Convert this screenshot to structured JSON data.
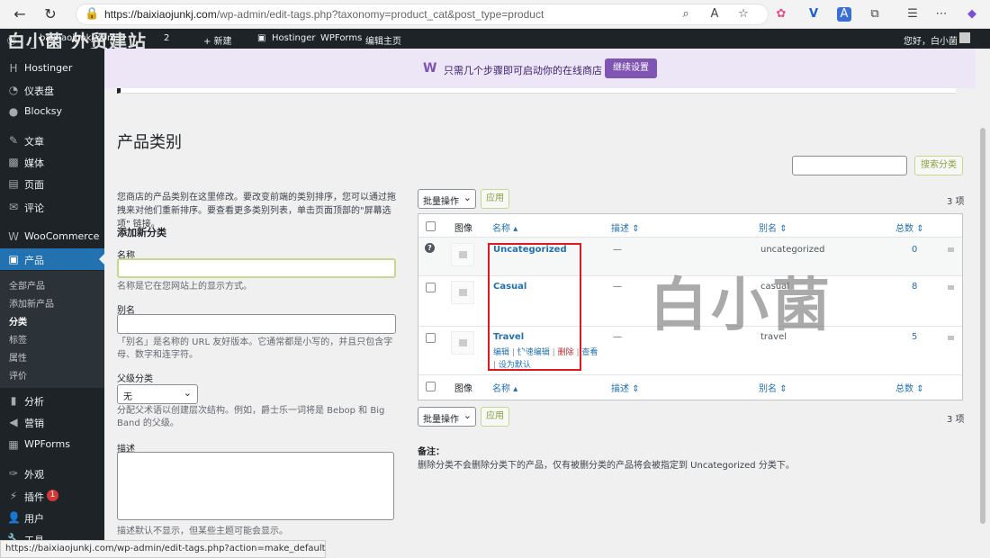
{
  "browser": {
    "url_base": "https://baixiaojunkj.com",
    "url_path": "/wp-admin/edit-tags.php?taxonomy=product_cat&post_type=product",
    "status_url": "https://baixiaojunkj.com/wp-admin/edit-tags.php?action=make_default&taxonom..."
  },
  "adminbar": {
    "site": "baixiaojunkj.com",
    "count": "2",
    "new_label": "+ 新建",
    "hostinger": "Hostinger",
    "wpforms": "WPForms",
    "edit_home": "编辑主页",
    "greeting": "您好，白小菌",
    "overlay_text": "白小菌 外贸建站"
  },
  "sidebar": {
    "items": [
      {
        "label": "Hostinger",
        "icon": "hostinger-icon"
      },
      {
        "label": "仪表盘",
        "icon": "dashboard-icon"
      },
      {
        "label": "Blocksy",
        "icon": "blocksy-icon"
      },
      {
        "label": "文章",
        "icon": "pin-icon"
      },
      {
        "label": "媒体",
        "icon": "media-icon"
      },
      {
        "label": "页面",
        "icon": "page-icon"
      },
      {
        "label": "评论",
        "icon": "comment-icon"
      },
      {
        "label": "WooCommerce",
        "icon": "woocommerce-icon"
      },
      {
        "label": "产品",
        "icon": "product-icon"
      },
      {
        "label": "分析",
        "icon": "analytics-icon"
      },
      {
        "label": "营销",
        "icon": "megaphone-icon"
      },
      {
        "label": "WPForms",
        "icon": "wpforms-icon"
      },
      {
        "label": "外观",
        "icon": "brush-icon"
      },
      {
        "label": "插件",
        "icon": "plugin-icon"
      },
      {
        "label": "用户",
        "icon": "user-icon"
      },
      {
        "label": "工具",
        "icon": "tool-icon"
      }
    ],
    "plugin_badge": "1",
    "submenu": [
      "全部产品",
      "添加新产品",
      "分类",
      "标签",
      "属性",
      "评价"
    ]
  },
  "banner": {
    "text": "只需几个步骤即可启动你的在线商店",
    "button": "继续设置"
  },
  "page": {
    "title": "产品类别",
    "intro": "您商店的产品类别在这里修改。要改变前端的类别排序，您可以通过拖拽来对他们重新排序。要查看更多类别列表，单击页面顶部的\"屏幕选项\" 链接。"
  },
  "form": {
    "heading": "添加新分类",
    "name_label": "名称",
    "name_help": "名称是它在您网站上的显示方式。",
    "slug_label": "别名",
    "slug_help": "「别名」是名称的 URL 友好版本。它通常都是小写的，并且只包含字母、数字和连字符。",
    "parent_label": "父级分类",
    "parent_value": "无",
    "parent_help": "分配父术语以创建层次结构。例如，爵士乐一词将是 Bebop 和 Big Band 的父级。",
    "desc_label": "描述",
    "desc_help": "描述默认不显示，但某些主题可能会显示。"
  },
  "list": {
    "search_button": "搜索分类",
    "bulk_label": "批量操作",
    "apply_label": "应用",
    "count": "3 项",
    "columns": {
      "image": "图像",
      "name": "名称",
      "desc": "描述",
      "slug": "别名",
      "count": "总数"
    },
    "rows": [
      {
        "name": "Uncategorized",
        "desc": "—",
        "slug": "uncategorized",
        "count": "0"
      },
      {
        "name": "Casual",
        "desc": "—",
        "slug": "casual",
        "count": "8"
      },
      {
        "name": "Travel",
        "desc": "—",
        "slug": "travel",
        "count": "5"
      }
    ],
    "row_actions": {
      "edit": "编辑",
      "quick_edit": "快速编辑",
      "delete": "删除",
      "view": "查看",
      "make_default": "设为默认"
    }
  },
  "notes": {
    "title": "备注：",
    "text": "删除分类不会删除分类下的产品，仅有被删分类的产品将会被指定到 Uncategorized 分类下。"
  },
  "watermark": "白小菌"
}
